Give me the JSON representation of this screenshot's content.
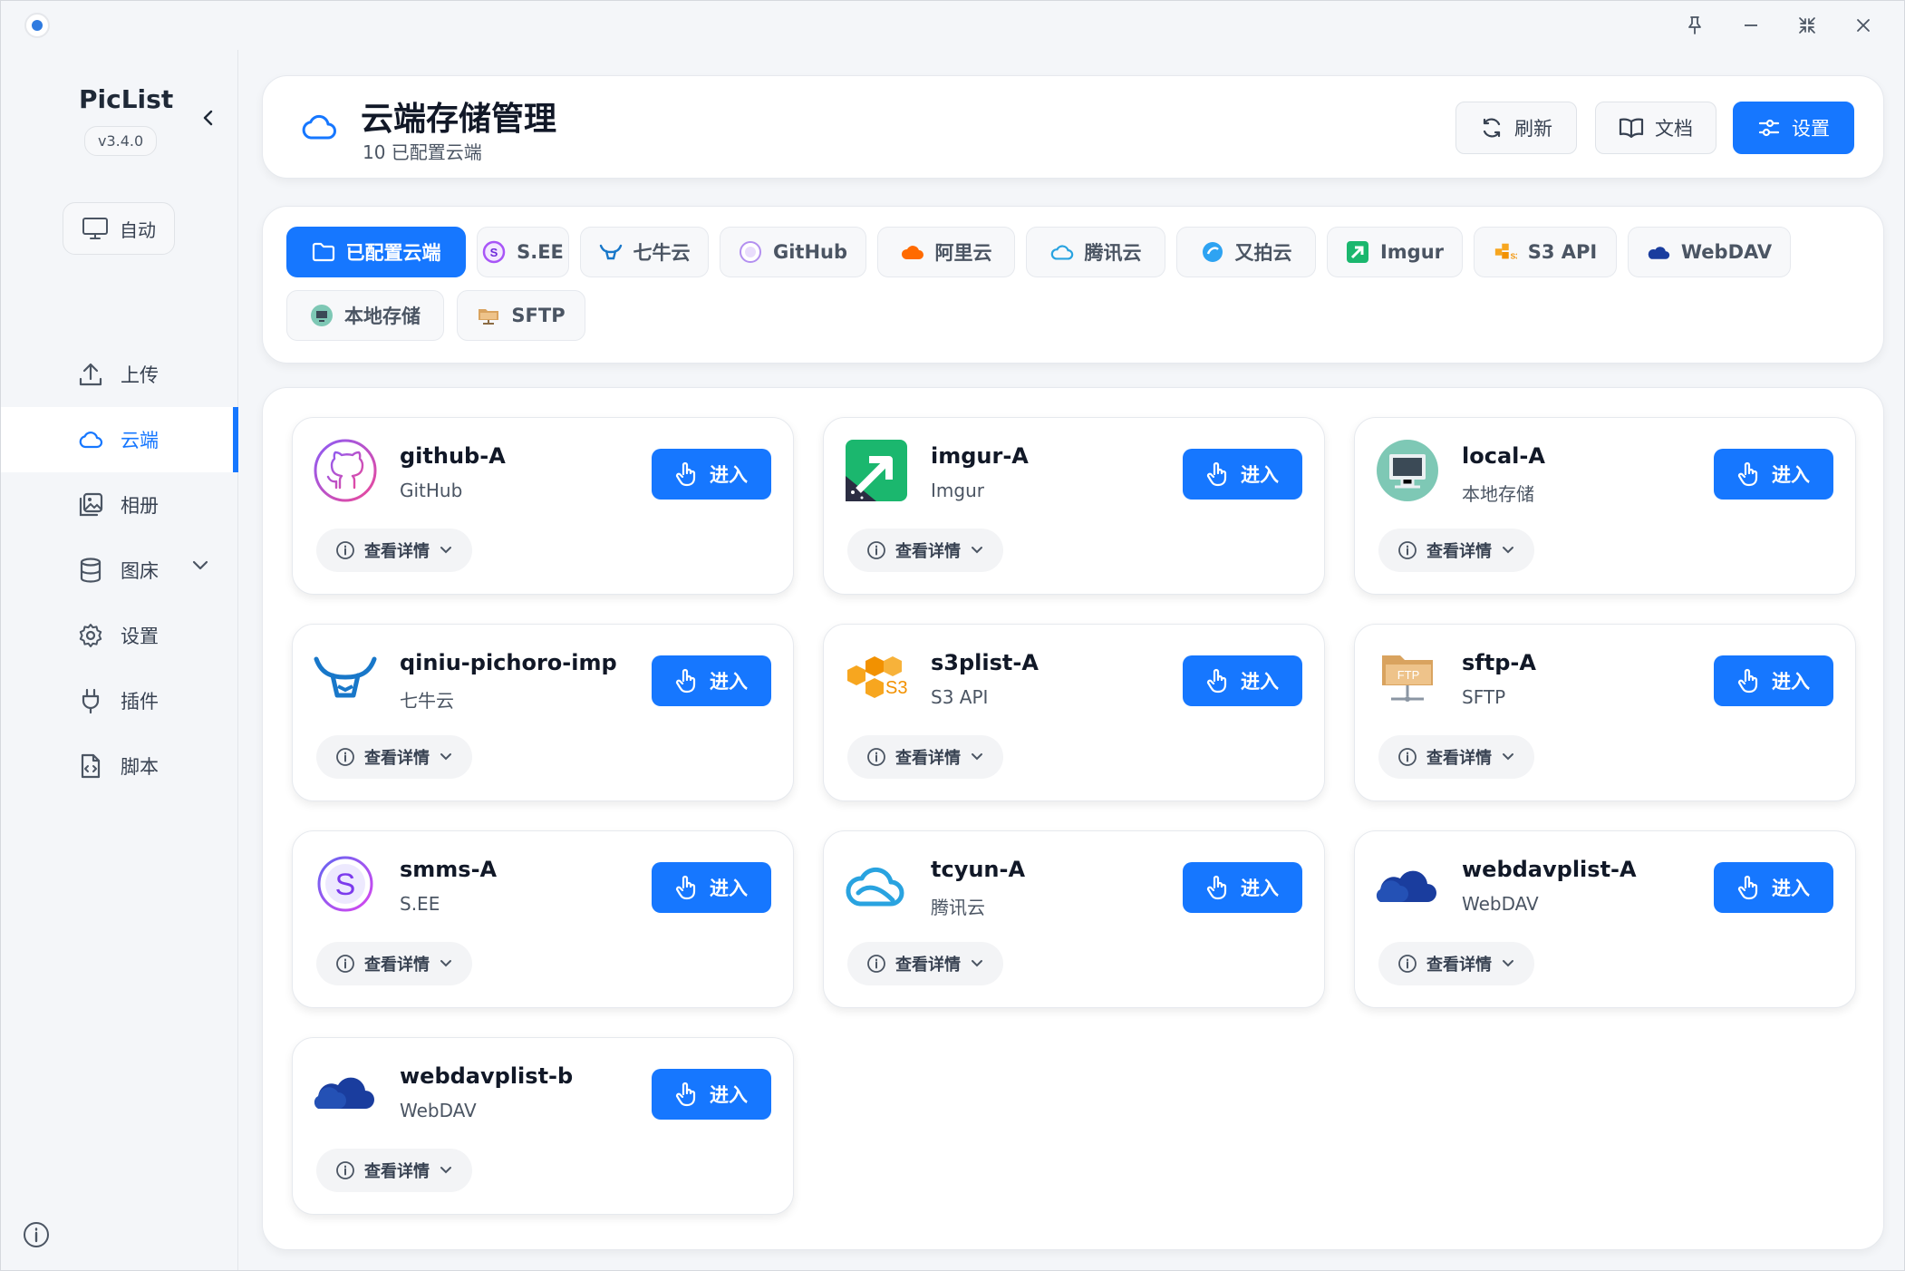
{
  "app": {
    "name": "PicList",
    "version": "v3.4.0",
    "auto_label": "自动"
  },
  "sidebar": {
    "items": [
      {
        "label": "上传",
        "icon": "upload-icon"
      },
      {
        "label": "云端",
        "icon": "cloud-icon",
        "active": true
      },
      {
        "label": "相册",
        "icon": "gallery-icon"
      },
      {
        "label": "图床",
        "icon": "database-icon",
        "expandable": true
      },
      {
        "label": "设置",
        "icon": "gear-icon"
      },
      {
        "label": "插件",
        "icon": "plug-icon"
      },
      {
        "label": "脚本",
        "icon": "script-icon"
      }
    ]
  },
  "header": {
    "title": "云端存储管理",
    "subtitle": "10 已配置云端",
    "refresh_label": "刷新",
    "docs_label": "文档",
    "settings_label": "设置"
  },
  "filters": [
    {
      "label": "已配置云端",
      "icon": "folder-icon",
      "active": true
    },
    {
      "label": "S.EE",
      "icon": "smms-logo"
    },
    {
      "label": "七牛云",
      "icon": "qiniu-logo"
    },
    {
      "label": "GitHub",
      "icon": "github-logo"
    },
    {
      "label": "阿里云",
      "icon": "aliyun-logo"
    },
    {
      "label": "腾讯云",
      "icon": "tencent-cloud-logo"
    },
    {
      "label": "又拍云",
      "icon": "upyun-logo"
    },
    {
      "label": "Imgur",
      "icon": "imgur-logo"
    },
    {
      "label": "S3 API",
      "icon": "s3-logo"
    },
    {
      "label": "WebDAV",
      "icon": "webdav-logo"
    },
    {
      "label": "本地存储",
      "icon": "local-storage-logo"
    },
    {
      "label": "SFTP",
      "icon": "sftp-logo"
    }
  ],
  "cards": [
    {
      "name": "github-A",
      "type": "GitHub",
      "logo": "github-logo"
    },
    {
      "name": "imgur-A",
      "type": "Imgur",
      "logo": "imgur-logo"
    },
    {
      "name": "local-A",
      "type": "本地存储",
      "logo": "local-storage-logo"
    },
    {
      "name": "qiniu-pichoro-imp",
      "type": "七牛云",
      "logo": "qiniu-logo"
    },
    {
      "name": "s3plist-A",
      "type": "S3 API",
      "logo": "s3-logo"
    },
    {
      "name": "sftp-A",
      "type": "SFTP",
      "logo": "sftp-logo"
    },
    {
      "name": "smms-A",
      "type": "S.EE",
      "logo": "smms-logo"
    },
    {
      "name": "tcyun-A",
      "type": "腾讯云",
      "logo": "tencent-cloud-logo"
    },
    {
      "name": "webdavplist-A",
      "type": "WebDAV",
      "logo": "webdav-logo"
    },
    {
      "name": "webdavplist-b",
      "type": "WebDAV",
      "logo": "webdav-logo"
    }
  ],
  "card_actions": {
    "enter_label": "进入",
    "details_label": "查看详情"
  },
  "colors": {
    "accent": "#1677ff",
    "background": "#f4f6f9"
  }
}
